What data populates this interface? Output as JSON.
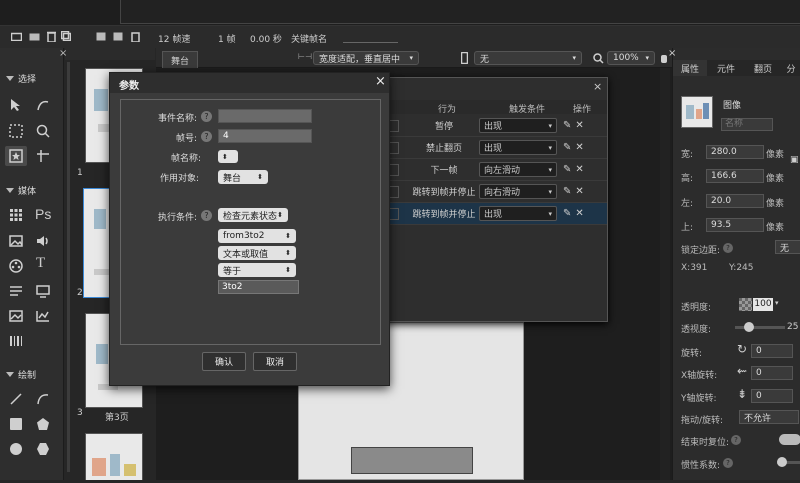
{
  "toolbar": {
    "fps": "12 帧速",
    "frame": "1 帧",
    "time": "0.00 秒",
    "keyframe_name": "关键帧名"
  },
  "stage_bar": {
    "tab": "舞台",
    "fit_option": "宽度适配，垂直居中",
    "device": "无",
    "zoom": "100%"
  },
  "left": {
    "select_title": "选择",
    "media_title": "媒体",
    "draw_title": "绘制",
    "pages": [
      {
        "num": "1",
        "label": ""
      },
      {
        "num": "2",
        "label": ""
      },
      {
        "num": "3",
        "label": "第3页"
      }
    ]
  },
  "events_table": {
    "headers": {
      "action": "行为",
      "trigger": "触发条件",
      "ops": "操作"
    },
    "rows": [
      {
        "action": "暂停",
        "trigger": "出现"
      },
      {
        "action": "禁止翻页",
        "trigger": "出现"
      },
      {
        "action": "下一帧",
        "trigger": "向左滑动"
      },
      {
        "action": "跳转到帧并停止",
        "trigger": "向右滑动"
      },
      {
        "action": "跳转到帧并停止",
        "trigger": "出现"
      }
    ]
  },
  "dialog": {
    "title": "参数",
    "fields": {
      "event_name_label": "事件名称:",
      "event_name_value": "",
      "frame_label": "帧号:",
      "frame_value": "4",
      "frame_name_label": "帧名称:",
      "target_label": "作用对象:",
      "target_value": "舞台",
      "condition_label": "执行条件:",
      "condition_value": "检查元素状态",
      "cond_element": "from3to2",
      "cond_prop": "文本或取值",
      "cond_op": "等于",
      "cond_value": "3to2"
    },
    "ok": "确认",
    "cancel": "取消"
  },
  "right": {
    "tabs": [
      "属性",
      "元件",
      "翻页",
      "分"
    ],
    "object_type": "图像",
    "name_placeholder": "名称",
    "width_label": "宽:",
    "width_value": "280.0",
    "height_label": "高:",
    "height_value": "166.6",
    "left_label": "左:",
    "left_value": "20.0",
    "top_label": "上:",
    "top_value": "93.5",
    "unit": "像素",
    "lock_margin_label": "锁定边距:",
    "lock_margin_value": "无",
    "x_readout": "X:391",
    "y_readout": "Y:245",
    "opacity_label": "透明度:",
    "opacity_value": "100",
    "transparency_label": "透视度:",
    "transparency_value": "25",
    "rotate_label": "旋转:",
    "rotate_value": "0",
    "xrot_label": "X轴旋转:",
    "xrot_value": "0",
    "yrot_label": "Y轴旋转:",
    "yrot_value": "0",
    "drag_label": "拖动/旋转:",
    "drag_value": "不允许",
    "reset_label": "结束时复位:",
    "inertia_label": "惯性系数:"
  }
}
